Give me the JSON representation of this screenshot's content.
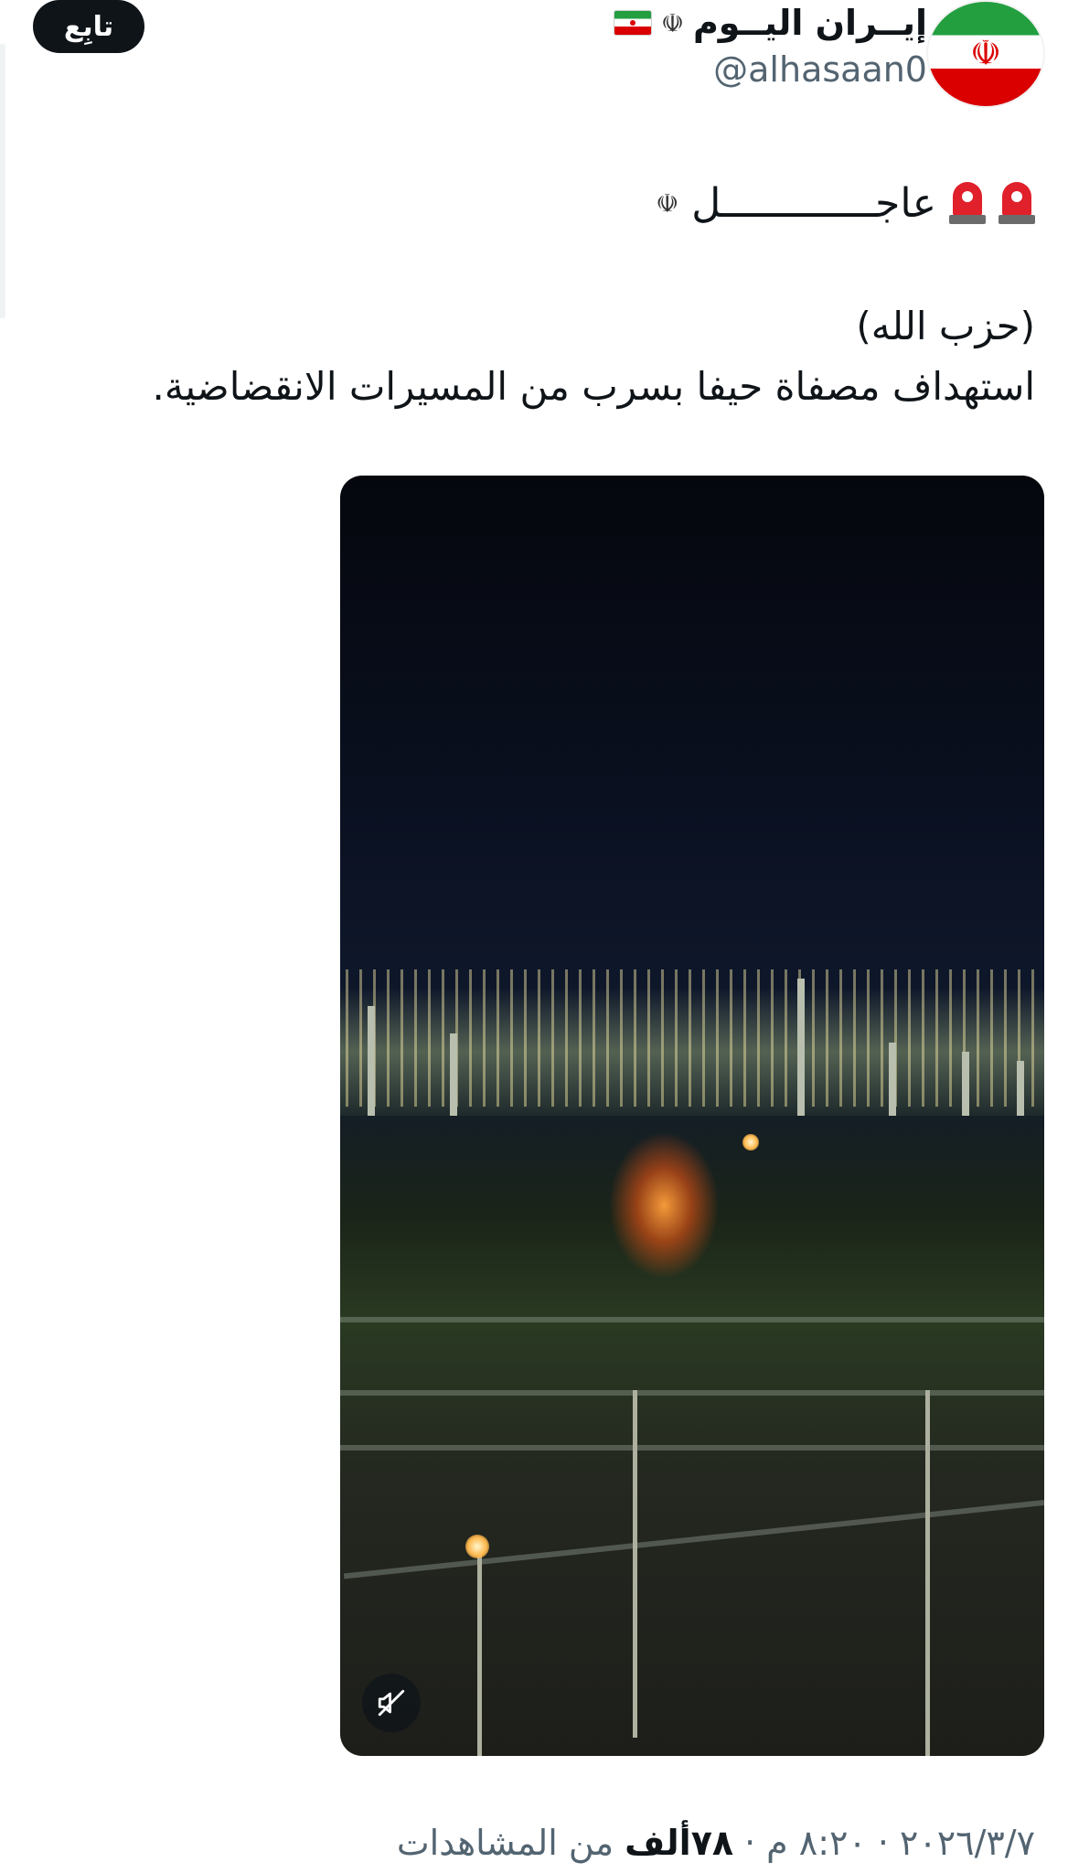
{
  "author": {
    "display_name": "إيــران اليــوم",
    "emblem_glyph": "☫",
    "handle": "@alhasaan0",
    "avatar_icon": "iran-flag-avatar-icon"
  },
  "follow_label": "تابِع",
  "tweet": {
    "headline_text": "عاجـــــــــــــل",
    "headline_emblem": "☫",
    "line1": "(حزب الله)",
    "line2": "استهداف مصفاة حيفا بسرب من المسيرات الانقضاضية."
  },
  "media": {
    "type": "video",
    "description_icon": "muted-speaker-icon"
  },
  "meta": {
    "time": "٨:٢٠ م",
    "date": "٢٠٢٦/٣/٧",
    "separator": "·",
    "views_count": "٧٨ألف",
    "views_label": "من المشاهدات"
  },
  "colors": {
    "text_primary": "#0f1419",
    "text_secondary": "#536471",
    "follow_bg": "#0f1419",
    "follow_fg": "#ffffff",
    "flag_green": "#239f40",
    "flag_red": "#da0000"
  }
}
